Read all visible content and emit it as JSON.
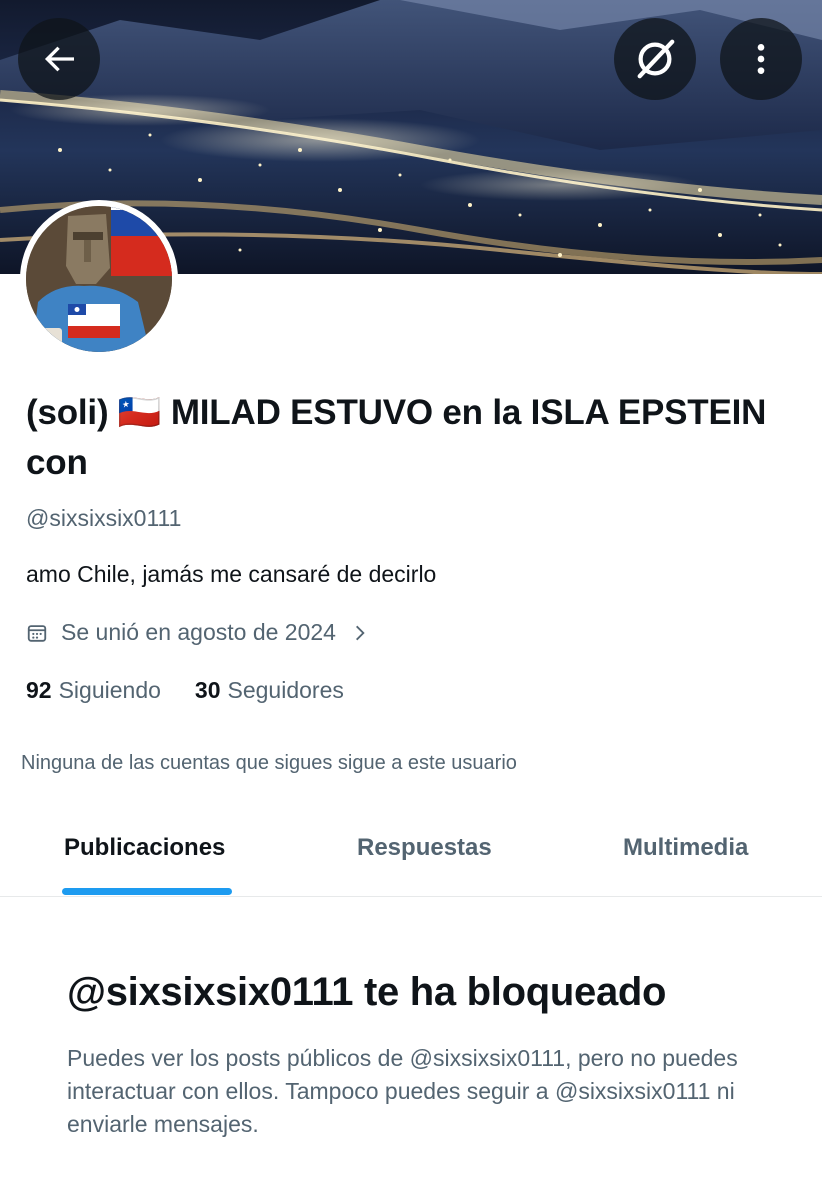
{
  "header": {
    "back_icon": "arrow-left-icon",
    "grok_icon": "grok-icon",
    "more_icon": "more-vertical-icon"
  },
  "profile": {
    "display_name": "(soli) 🇨🇱 MILAD ESTUVO en la ISLA EPSTEIN con",
    "handle": "@sixsixsix0111",
    "bio": "amo Chile, jamás me cansaré de decirlo",
    "joined": "Se unió en agosto de 2024",
    "following_count": "92",
    "following_label": "Siguiendo",
    "followers_count": "30",
    "followers_label": "Seguidores",
    "mutuals_text": "Ninguna de las cuentas que sigues sigue a este usuario"
  },
  "tabs": [
    {
      "label": "Publicaciones",
      "active": true
    },
    {
      "label": "Respuestas",
      "active": false
    },
    {
      "label": "Multimedia",
      "active": false
    }
  ],
  "blocked": {
    "title": "@sixsixsix0111 te ha bloqueado",
    "description": "Puedes ver los posts públicos de @sixsixsix0111, pero no puedes interactuar con ellos. Tampoco puedes seguir a @sixsixsix0111 ni enviarle mensajes."
  },
  "colors": {
    "accent": "#1d9bf0",
    "text_primary": "#0f1419",
    "text_secondary": "#536471"
  }
}
